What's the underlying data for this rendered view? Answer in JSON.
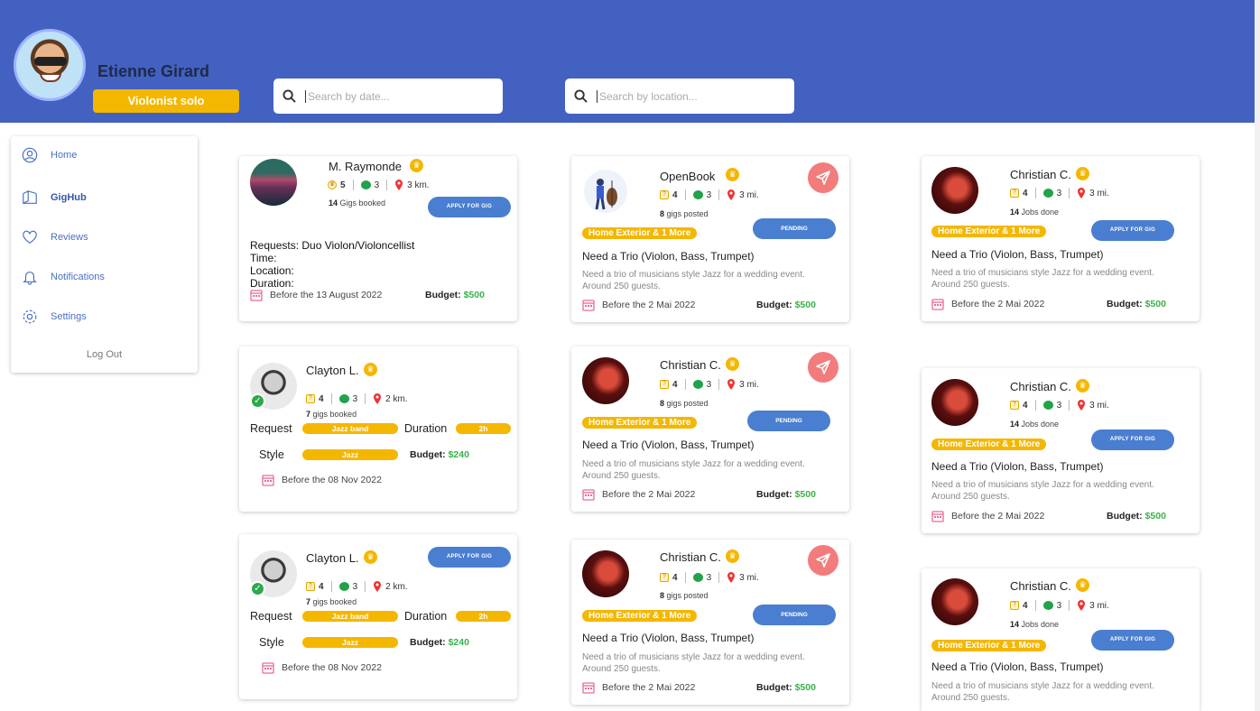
{
  "user": {
    "name": "Etienne Girard",
    "role": "Violonist solo"
  },
  "search": {
    "date_placeholder": "Search by date...",
    "location_placeholder": "Search by location..."
  },
  "sidebar": {
    "items": [
      {
        "label": "Home",
        "icon": "user-circle-icon"
      },
      {
        "label": "GigHub",
        "icon": "book-icon"
      },
      {
        "label": "Reviews",
        "icon": "heart-icon"
      },
      {
        "label": "Notifications",
        "icon": "bell-icon"
      },
      {
        "label": "Settings",
        "icon": "gear-icon"
      }
    ],
    "logout": "Log Out"
  },
  "colors": {
    "header": "#4361c0",
    "accent_yellow": "#f4b700",
    "button_blue": "#4a7ed0",
    "send_red": "#f27c7c",
    "budget_green": "#3ab24a"
  },
  "cards": {
    "c1": {
      "name": "M. Raymonde",
      "rating": "5",
      "messages": "3",
      "distance": "3 km.",
      "count": "14",
      "count_label": "Gigs booked",
      "button": "APPLY FOR GIG",
      "req_label": "Requests: Duo Violon/Violoncellist",
      "time_label": "Time:",
      "loc_label": "Location:",
      "dur_label": "Duration:",
      "date": "Before the 13 August 2022",
      "budget_label": "Budget:",
      "budget": "$500"
    },
    "c2": {
      "name": "Clayton L.",
      "rating": "4",
      "messages": "3",
      "distance": "2 km.",
      "count": "7",
      "count_label": "gigs booked",
      "request_label": "Request",
      "request": "Jazz band",
      "duration_label": "Duration",
      "duration": "2h",
      "style_label": "Style",
      "style": "Jazz",
      "budget_label": "Budget:",
      "budget": "$240",
      "date": "Before the 08 Nov 2022"
    },
    "c3": {
      "name": "Clayton L.",
      "rating": "4",
      "messages": "3",
      "distance": "2 km.",
      "count": "7",
      "count_label": "gigs booked",
      "button": "APPLY FOR GIG",
      "request_label": "Request",
      "request": "Jazz band",
      "duration_label": "Duration",
      "duration": "2h",
      "style_label": "Style",
      "style": "Jazz",
      "budget_label": "Budget:",
      "budget": "$240",
      "date": "Before the 08 Nov 2022"
    },
    "c4": {
      "name": "OpenBook",
      "rating": "4",
      "messages": "3",
      "distance": "3 mi.",
      "count": "8",
      "count_label": "gigs posted",
      "button": "PENDING",
      "tag": "Home Exterior & 1 More",
      "title": "Need a Trio (Violon, Bass, Trumpet)",
      "desc": "Need a trio of musicians style Jazz for a wedding event. Around 250 guests.",
      "date": "Before the 2 Mai 2022",
      "budget_label": "Budget:",
      "budget": "$500"
    },
    "c5": {
      "name": "Christian C.",
      "rating": "4",
      "messages": "3",
      "distance": "3 mi.",
      "count": "8",
      "count_label": "gigs posted",
      "button": "PENDING",
      "tag": "Home Exterior & 1 More",
      "title": "Need a Trio (Violon, Bass, Trumpet)",
      "desc": "Need a trio of musicians style Jazz for a wedding event. Around 250 guests.",
      "date": "Before the 2 Mai 2022",
      "budget_label": "Budget:",
      "budget": "$500"
    },
    "c6": {
      "name": "Christian C.",
      "rating": "4",
      "messages": "3",
      "distance": "3 mi.",
      "count": "8",
      "count_label": "gigs posted",
      "button": "PENDING",
      "tag": "Home Exterior & 1 More",
      "title": "Need a Trio (Violon, Bass, Trumpet)",
      "desc": "Need a trio of musicians style Jazz for a wedding event. Around 250 guests.",
      "date": "Before the 2 Mai 2022",
      "budget_label": "Budget:",
      "budget": "$500"
    },
    "c7": {
      "name": "Christian C.",
      "rating": "4",
      "messages": "3",
      "distance": "3 mi.",
      "count": "14",
      "count_label": "Jobs done",
      "button": "APPLY FOR GIG",
      "tag": "Home Exterior & 1 More",
      "title": "Need a Trio (Violon, Bass, Trumpet)",
      "desc": "Need a trio of musicians style Jazz for a wedding event. Around 250 guests.",
      "date": "Before the 2 Mai 2022",
      "budget_label": "Budget:",
      "budget": "$500"
    },
    "c8": {
      "name": "Christian C.",
      "rating": "4",
      "messages": "3",
      "distance": "3 mi.",
      "count": "14",
      "count_label": "Jobs done",
      "button": "APPLY FOR GIG",
      "tag": "Home Exterior & 1 More",
      "title": "Need a Trio (Violon, Bass, Trumpet)",
      "desc": "Need a trio of musicians style Jazz for a wedding event. Around 250 guests.",
      "date": "Before the 2 Mai 2022",
      "budget_label": "Budget:",
      "budget": "$500"
    },
    "c9": {
      "name": "Christian C.",
      "rating": "4",
      "messages": "3",
      "distance": "3 mi.",
      "count": "14",
      "count_label": "Jobs done",
      "button": "APPLY FOR GIG",
      "tag": "Home Exterior & 1 More",
      "title": "Need a Trio (Violon, Bass, Trumpet)",
      "desc": "Need a trio of musicians style Jazz for a wedding event. Around 250 guests."
    }
  }
}
